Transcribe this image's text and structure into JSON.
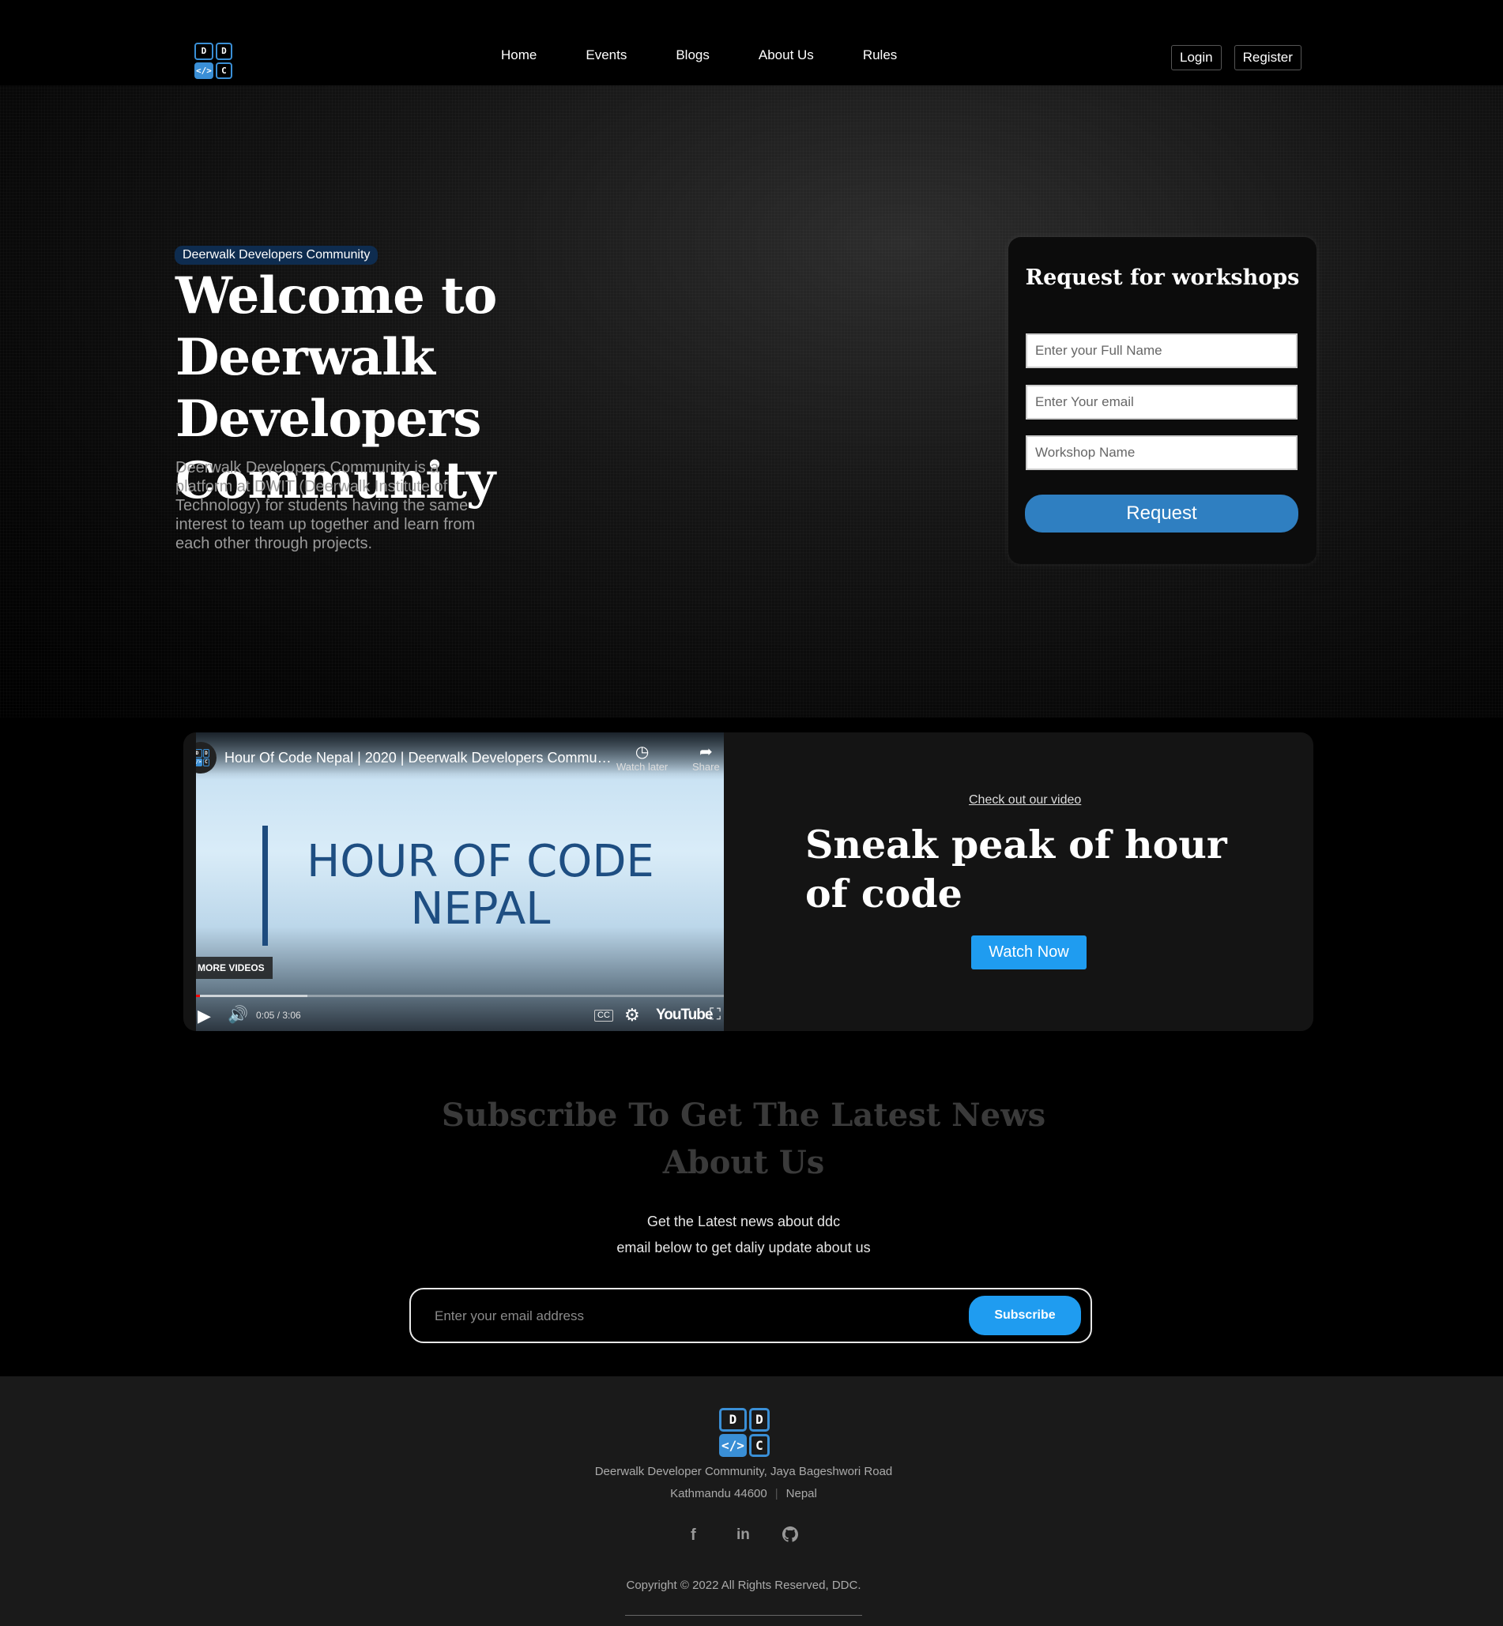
{
  "nav": {
    "logo_letters": [
      "D",
      "D",
      "</>",
      "C"
    ],
    "links": [
      "Home",
      "Events",
      "Blogs",
      "About Us",
      "Rules"
    ],
    "login": "Login",
    "register": "Register"
  },
  "hero": {
    "badge": "Deerwalk Developers Community",
    "title": "Welcome to Deerwalk Developers Community",
    "description": "Deerwalk Developers Community is a platform at DWIT (Deerwalk Institute of Technology) for students having the same interest to team up together and learn from each other through projects."
  },
  "workshop_form": {
    "title": "Request for workshops",
    "name_placeholder": "Enter your Full Name",
    "email_placeholder": "Enter Your email",
    "workshop_placeholder": "Workshop Name",
    "submit_label": "Request"
  },
  "video": {
    "player_title": "Hour Of Code Nepal | 2020 | Deerwalk Developers Commun...",
    "watch_later": "Watch later",
    "share": "Share",
    "thumbnail_text": "HOUR OF CODE NEPAL",
    "more_videos": "MORE VIDEOS",
    "time": "0:05 / 3:06",
    "progress_fraction": 0.027,
    "brand": "YouTube",
    "kicker": "Check out our video",
    "heading": "Sneak peak of hour of code",
    "watch_label": "Watch Now"
  },
  "subscribe": {
    "title": "Subscribe To Get The Latest News About Us",
    "line1": "Get the Latest news about ddc",
    "line2": "email below to get daliy update about us",
    "email_placeholder": "Enter your email address",
    "button": "Subscribe"
  },
  "footer": {
    "address_line1": "Deerwalk Developer Community, Jaya Bageshwori Road",
    "city": "Kathmandu 44600",
    "country": "Nepal",
    "socials": [
      "facebook-icon",
      "linkedin-icon",
      "github-icon"
    ],
    "copyright": "Copyright © 2022 All Rights Reserved, DDC."
  },
  "colors": {
    "accent": "#1f9cf0",
    "request_button": "#2f7fc1",
    "badge_bg": "#0e2c4f",
    "logo_blue": "#3a8fd6"
  }
}
